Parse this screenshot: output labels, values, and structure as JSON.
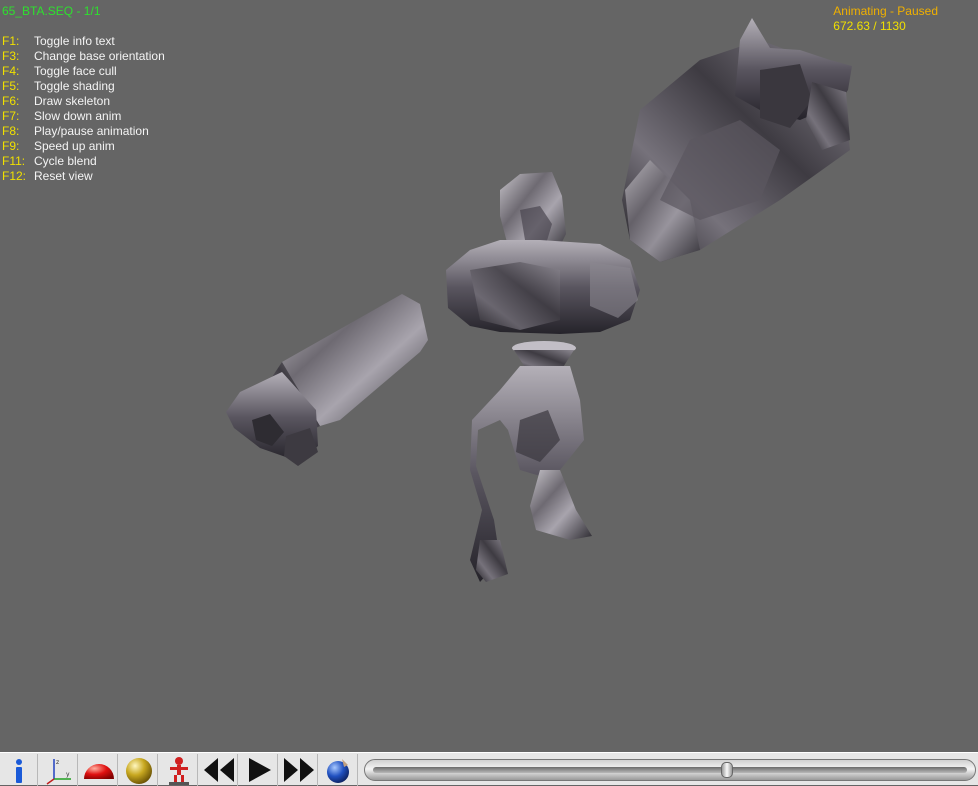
{
  "viewer": {
    "sequence_title": "65_BTA.SEQ - 1/1",
    "status": "Animating - Paused",
    "frame_counter": "672.63 / 1130",
    "background_color": "#656565"
  },
  "help": [
    {
      "key": "F1:",
      "desc": "Toggle info text"
    },
    {
      "key": "F3:",
      "desc": "Change base orientation"
    },
    {
      "key": "F4:",
      "desc": "Toggle face cull"
    },
    {
      "key": "F5:",
      "desc": "Toggle shading"
    },
    {
      "key": "F6:",
      "desc": "Draw skeleton"
    },
    {
      "key": "F7:",
      "desc": "Slow down anim"
    },
    {
      "key": "F8:",
      "desc": "Play/pause animation"
    },
    {
      "key": "F9:",
      "desc": "Speed up anim"
    },
    {
      "key": "F11:",
      "desc": "Cycle blend"
    },
    {
      "key": "F12:",
      "desc": "Reset view"
    }
  ],
  "toolbar": {
    "buttons": [
      {
        "name": "info-icon"
      },
      {
        "name": "axes-icon"
      },
      {
        "name": "red-dome-icon"
      },
      {
        "name": "shaded-sphere-icon"
      },
      {
        "name": "skeleton-figure-icon"
      },
      {
        "name": "rewind-icon"
      },
      {
        "name": "play-icon"
      },
      {
        "name": "fast-forward-icon"
      },
      {
        "name": "globe-icon"
      }
    ],
    "progress": {
      "current": 672.63,
      "total": 1130
    }
  }
}
